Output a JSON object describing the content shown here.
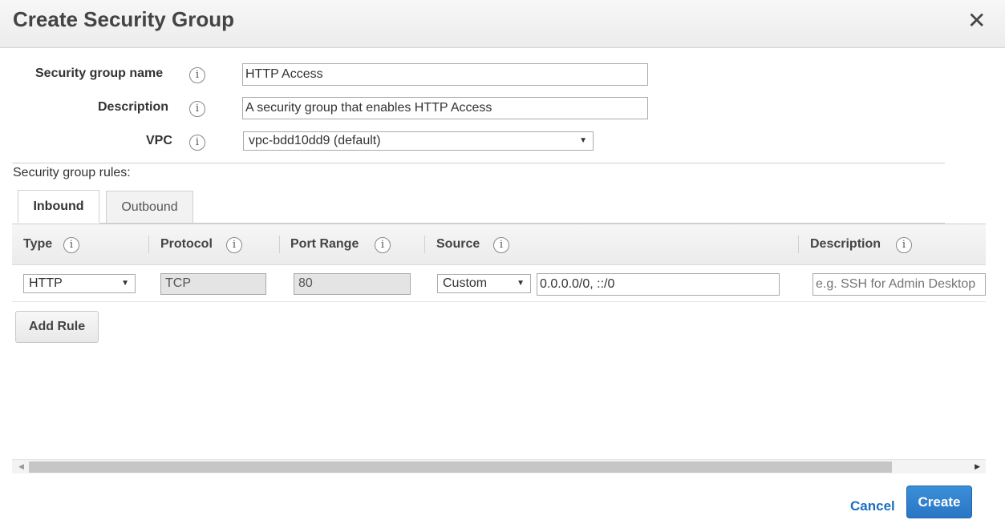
{
  "dialog": {
    "title": "Create Security Group",
    "close_icon": "close-icon"
  },
  "form": {
    "name_label": "Security group name",
    "name_value": "HTTP Access",
    "description_label": "Description",
    "description_value": "A security group that enables HTTP Access",
    "vpc_label": "VPC",
    "vpc_value": "vpc-bdd10dd9 (default)",
    "info_glyph": "i"
  },
  "rules": {
    "label": "Security group rules:",
    "tabs": [
      {
        "label": "Inbound",
        "active": true
      },
      {
        "label": "Outbound",
        "active": false
      }
    ],
    "columns": [
      "Type",
      "Protocol",
      "Port Range",
      "Source",
      "Description"
    ],
    "rows": [
      {
        "type": "HTTP",
        "protocol": "TCP",
        "port_range": "80",
        "source_type": "Custom",
        "source_value": "0.0.0.0/0, ::/0",
        "description_placeholder": "e.g. SSH for Admin Desktop"
      }
    ],
    "add_rule_label": "Add Rule"
  },
  "footer": {
    "cancel_label": "Cancel",
    "create_label": "Create"
  },
  "colors": {
    "primary_button": "#2a76c4",
    "link": "#1a6fbf"
  }
}
